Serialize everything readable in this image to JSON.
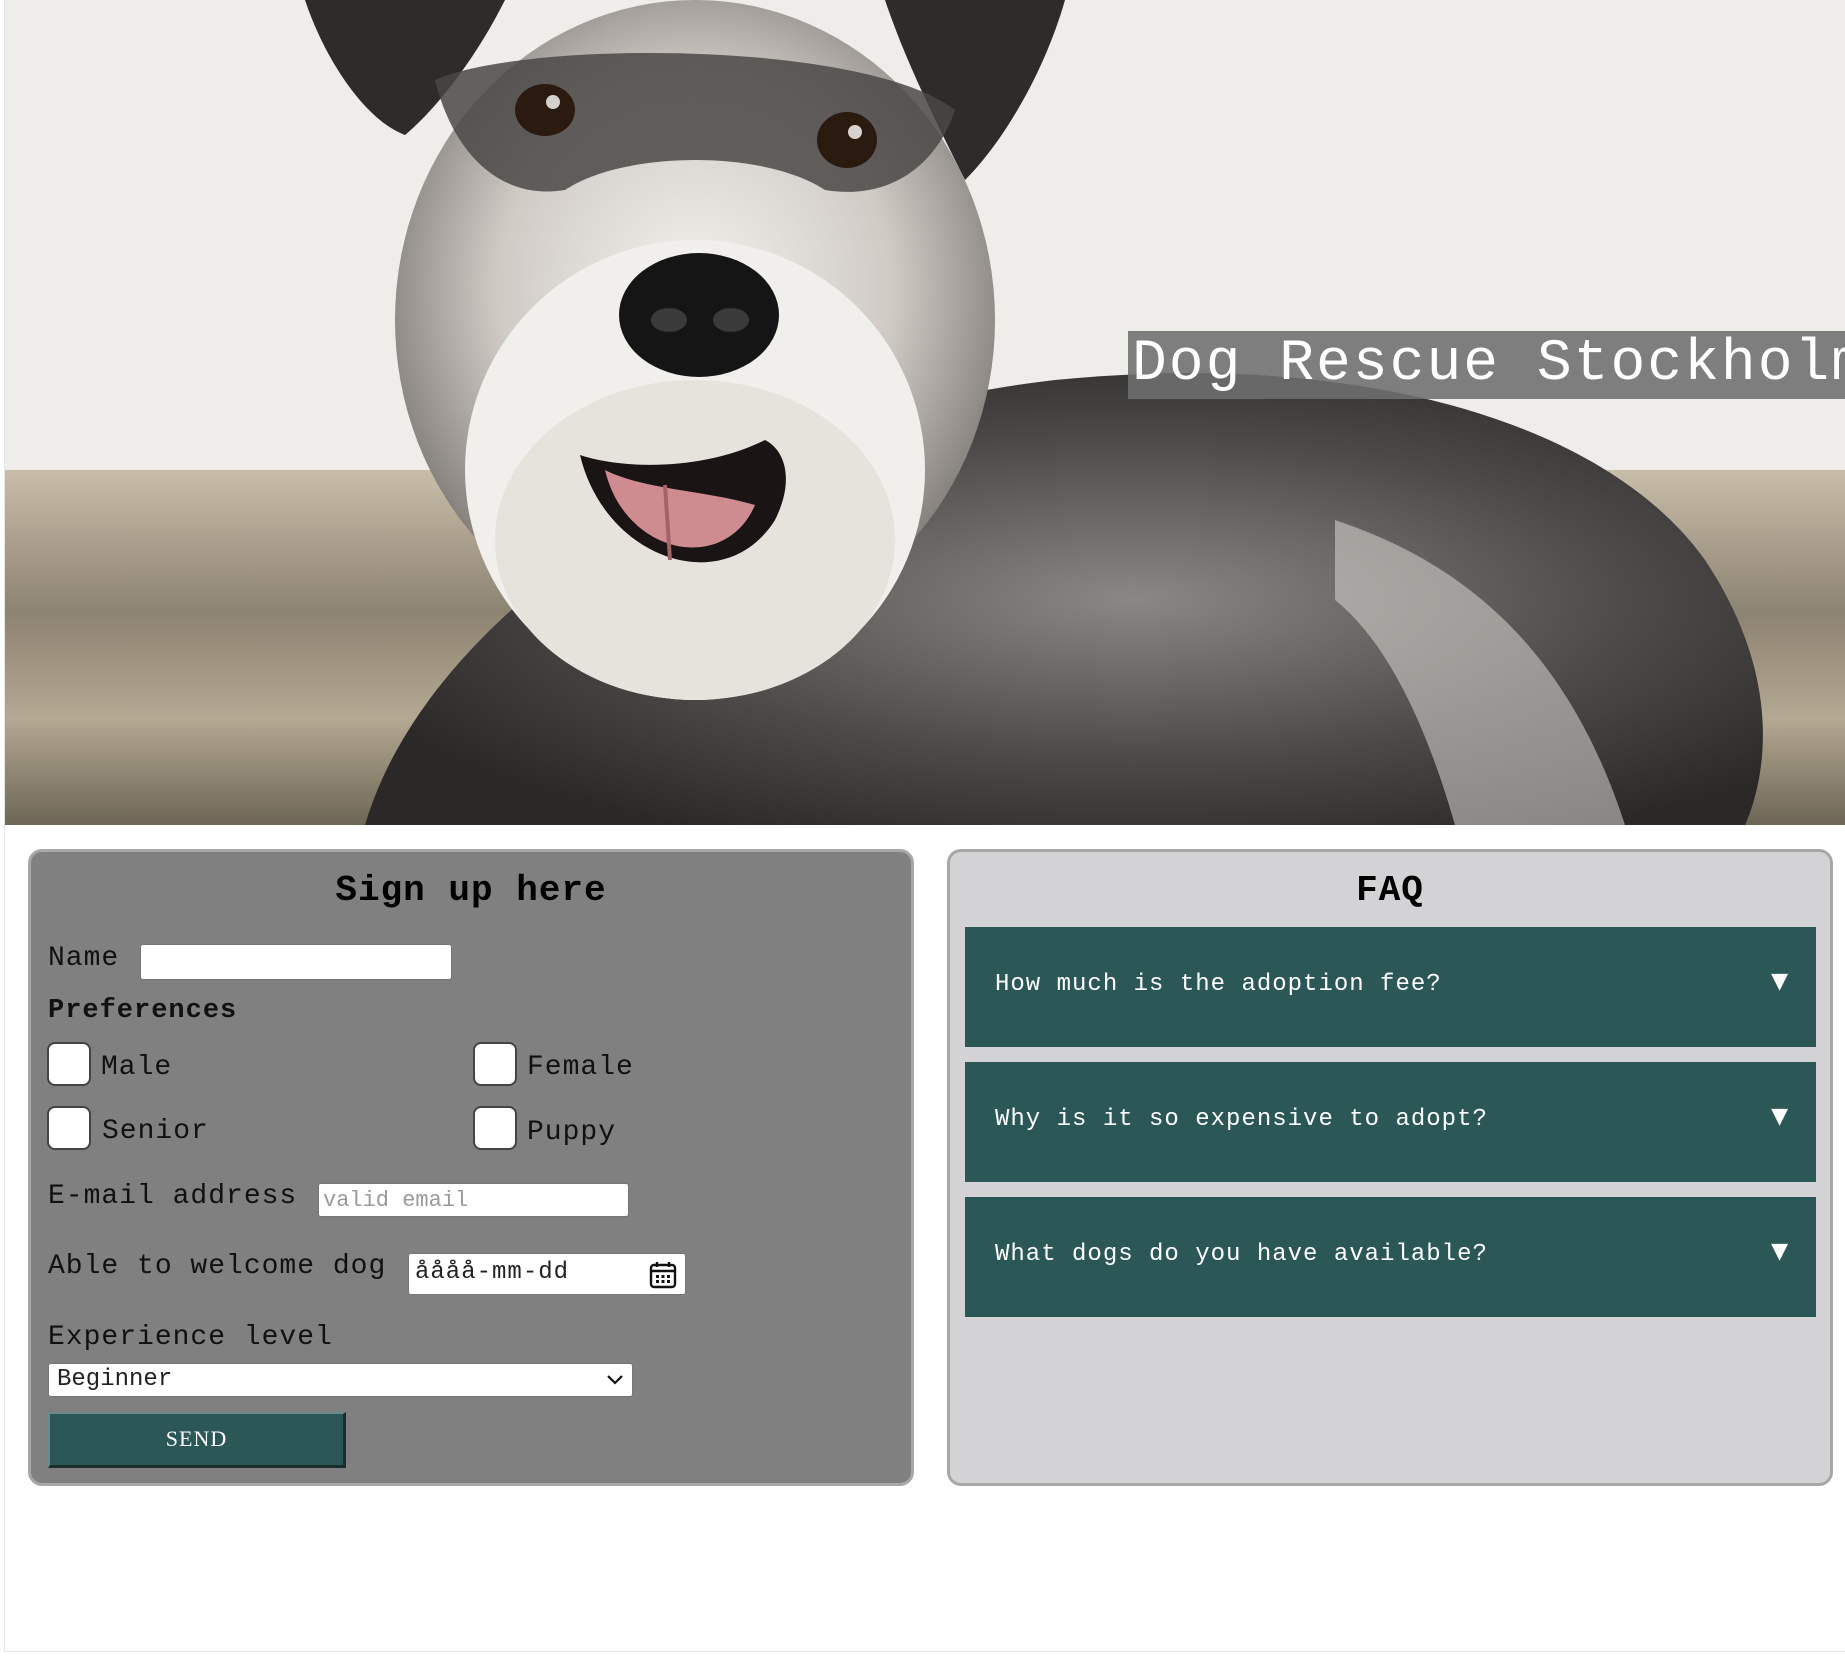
{
  "hero": {
    "title": "Dog Rescue Stockholm"
  },
  "signup": {
    "title": "Sign up here",
    "name_label": "Name",
    "name_value": "",
    "preferences_label": "Preferences",
    "preferences": [
      {
        "label": "Male",
        "checked": false
      },
      {
        "label": "Female",
        "checked": false
      },
      {
        "label": "Senior",
        "checked": false
      },
      {
        "label": "Puppy",
        "checked": false
      }
    ],
    "email_label": "E-mail address",
    "email_placeholder": "valid email",
    "date_label": "Able to welcome dog",
    "date_value": "åååå-mm-dd",
    "experience_label": "Experience level",
    "experience_value": "Beginner",
    "send_label": "SEND"
  },
  "faq": {
    "title": "FAQ",
    "items": [
      {
        "question": "How much is the adoption fee?",
        "arrow": "▼"
      },
      {
        "question": "Why is it so expensive to adopt?",
        "arrow": "▼"
      },
      {
        "question": "What dogs do you have available?",
        "arrow": "▼"
      }
    ]
  },
  "colors": {
    "accent": "#2c5757",
    "signup_bg": "#808080",
    "faq_bg": "#d3d3d5",
    "panel_border": "#a7a7a7"
  },
  "icons": {
    "calendar": "calendar-icon",
    "select_chevron": "chevron-down-icon",
    "faq_toggle": "triangle-down-icon"
  }
}
